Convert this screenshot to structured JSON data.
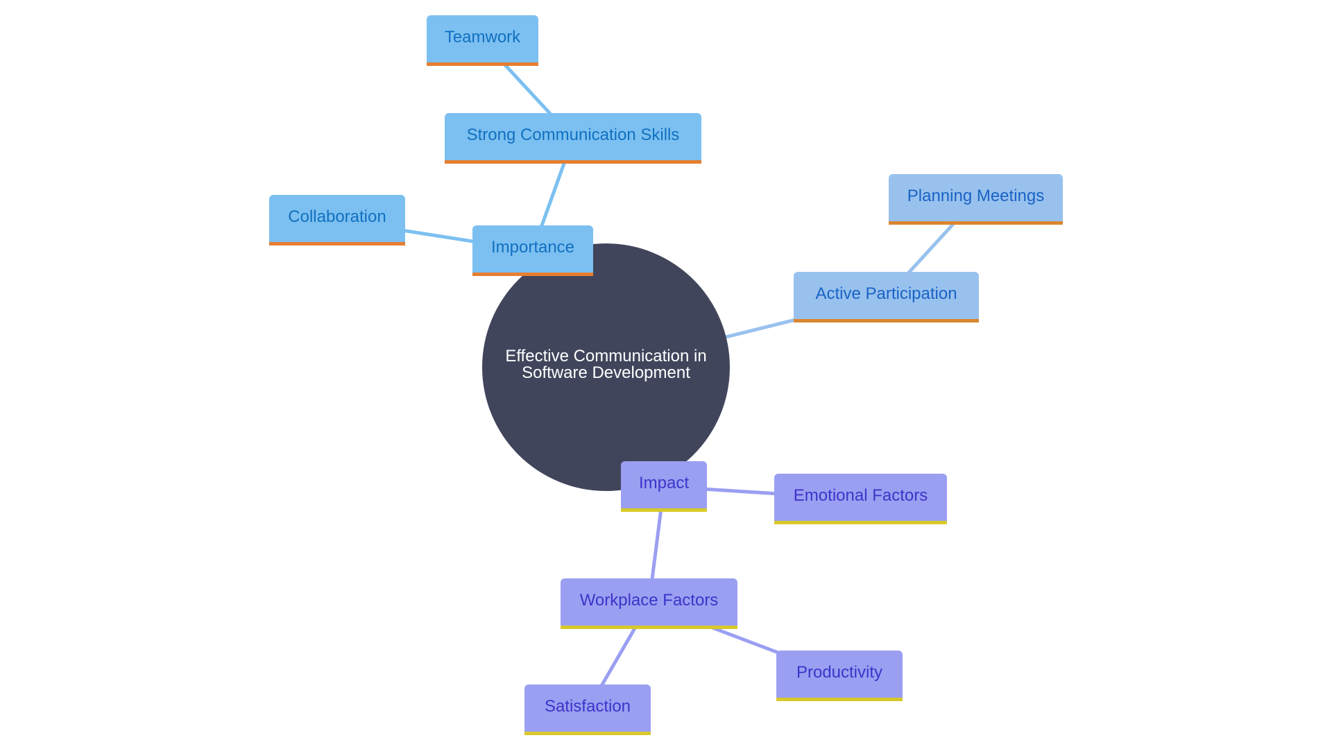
{
  "diagram": {
    "type": "mindmap",
    "root": {
      "id": "root",
      "label_line1": "Effective Communication in",
      "label_line2": "Software Development",
      "color": "#41455c"
    },
    "colors": {
      "importance_branch": {
        "fill": "#7cc0f1",
        "text": "#1170c0",
        "accent": "#e67e30"
      },
      "participation_branch": {
        "fill": "#98c1ee",
        "text": "#1a63c4",
        "accent": "#d9862f"
      },
      "impact_branch": {
        "fill": "#9b9ff2",
        "text": "#3b35c8",
        "accent": "#d8c92a"
      }
    },
    "nodes": {
      "importance": {
        "label": "Importance",
        "parent": "root"
      },
      "strong_comm": {
        "label": "Strong Communication Skills",
        "parent": "importance"
      },
      "teamwork": {
        "label": "Teamwork",
        "parent": "strong_comm"
      },
      "collaboration": {
        "label": "Collaboration",
        "parent": "importance"
      },
      "active_participation": {
        "label": "Active Participation",
        "parent": "root"
      },
      "planning_meetings": {
        "label": "Planning Meetings",
        "parent": "active_participation"
      },
      "impact": {
        "label": "Impact",
        "parent": "root"
      },
      "emotional_factors": {
        "label": "Emotional Factors",
        "parent": "impact"
      },
      "workplace_factors": {
        "label": "Workplace Factors",
        "parent": "impact"
      },
      "productivity": {
        "label": "Productivity",
        "parent": "workplace_factors"
      },
      "satisfaction": {
        "label": "Satisfaction",
        "parent": "workplace_factors"
      }
    }
  }
}
